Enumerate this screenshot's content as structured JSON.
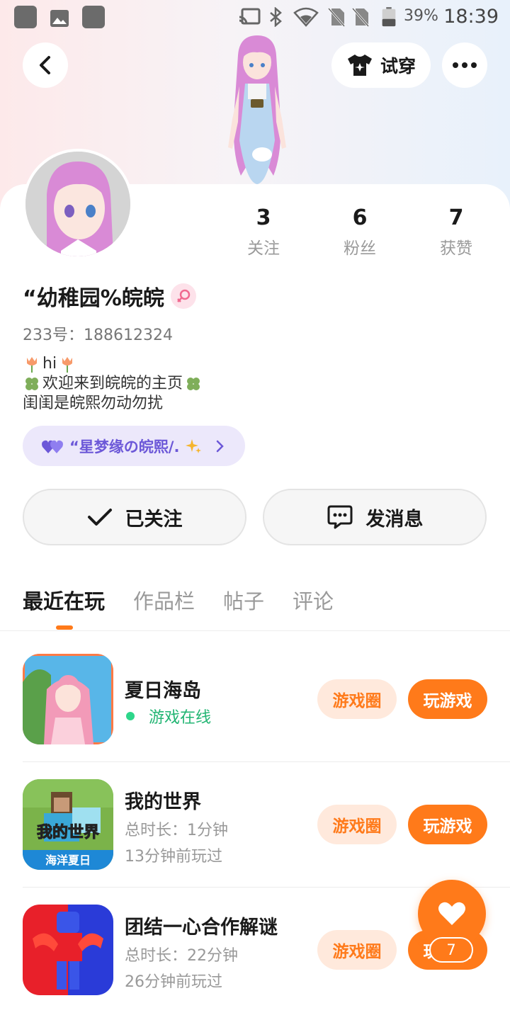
{
  "status_bar": {
    "battery": "39%",
    "time": "18:39",
    "icons": [
      "cast-icon",
      "bluetooth-icon",
      "wifi-icon",
      "no-sim-icon",
      "no-sim-icon",
      "battery-icon"
    ]
  },
  "header": {
    "back_icon": "chevron-left-icon",
    "tryon_icon": "tshirt-icon",
    "tryon_label": "试穿",
    "more_icon": "more-dots-icon"
  },
  "profile": {
    "stats": [
      {
        "value": "3",
        "label": "关注"
      },
      {
        "value": "6",
        "label": "粉丝"
      },
      {
        "value": "7",
        "label": "获赞"
      }
    ],
    "username": "“幼稚园%皖皖",
    "gender_icon": "female-icon",
    "uid": "233号：188612324",
    "bio": {
      "line1": "hi",
      "line2": "欢迎来到皖皖的主页",
      "line3": "闺闺是皖熙勿动勿扰"
    },
    "fan_tag": "“星梦缘の皖熙/.",
    "follow_label": "已关注",
    "message_label": "发消息"
  },
  "tabs": [
    {
      "label": "最近在玩",
      "active": true
    },
    {
      "label": "作品栏",
      "active": false
    },
    {
      "label": "帖子",
      "active": false
    },
    {
      "label": "评论",
      "active": false
    }
  ],
  "games": [
    {
      "title": "夏日海岛",
      "status": "游戏在线",
      "circle_label": "游戏圈",
      "play_label": "玩游戏"
    },
    {
      "title": "我的世界",
      "duration": "总时长：1分钟",
      "last_played": "13分钟前玩过",
      "icon_text": "我的世界",
      "icon_banner": "海洋夏日",
      "circle_label": "游戏圈",
      "play_label": "玩游戏"
    },
    {
      "title": "团结一心合作解谜",
      "duration": "总时长：22分钟",
      "last_played": "26分钟前玩过",
      "circle_label": "游戏圈",
      "play_label": "玩游戏"
    }
  ],
  "fab": {
    "icon": "heart-icon",
    "count": "7"
  },
  "colors": {
    "accent": "#ff7a1a",
    "online": "#22b573",
    "fan_tag": "#6c58d8"
  }
}
